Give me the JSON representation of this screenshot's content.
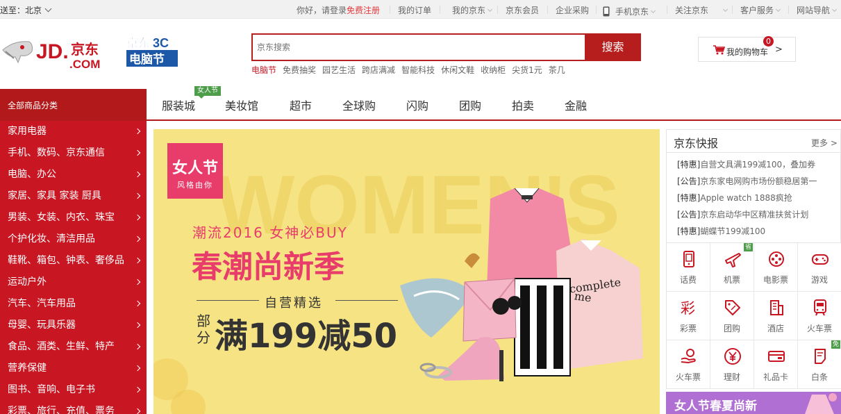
{
  "topbar": {
    "location_label": "送至：北京",
    "greeting": "你好，请登录",
    "register": "免费注册",
    "links": [
      "我的订单",
      "我的京东",
      "京东会员",
      "企业采购",
      "手机京东",
      "关注京东",
      "客户服务",
      "网站导航"
    ]
  },
  "header": {
    "logo_text": "JD.京东 .COM",
    "promo_logo_text": "京东电脑节",
    "search_placeholder": "京东搜索",
    "search_button": "搜索",
    "hotwords": [
      "电脑节",
      "免费抽奖",
      "园艺生活",
      "跨店满减",
      "智能科技",
      "休闲文鞋",
      "收纳柜",
      "尖货1元",
      "茶几"
    ],
    "cart_label": "我的购物车",
    "cart_arrow": ">",
    "cart_count": "0"
  },
  "nav": {
    "all_categories": "全部商品分类",
    "items": [
      "服装城",
      "美妆馆",
      "超市",
      "全球购",
      "闪购",
      "团购",
      "拍卖",
      "金融"
    ],
    "badge": "女人节"
  },
  "categories": [
    "家用电器",
    "手机、数码、京东通信",
    "电脑、办公",
    "家居、家具 家装 厨具",
    "男装、女装、内衣、珠宝",
    "个护化妆、清洁用品",
    "鞋靴、箱包、钟表、奢侈品",
    "运动户外",
    "汽车、汽车用品",
    "母婴、玩具乐器",
    "食品、酒类、生鲜、特产",
    "营养保健",
    "图书、音响、电子书",
    "彩票、旅行、充值、票务"
  ],
  "banner": {
    "brand_title": "女人节",
    "brand_sub": "风格由你",
    "bg_text": "WOMEN'S",
    "line1": "潮流2016  女神必BUY",
    "headline": "春潮尚新季",
    "self_pick": "自营精选",
    "partial": "部分",
    "offer": "满199减50",
    "sweater_text": "complete me"
  },
  "news": {
    "title": "京东快报",
    "more": "更多 >",
    "items": [
      {
        "tag": "[特惠]",
        "text": "自营文具满199减100，叠加券"
      },
      {
        "tag": "[公告]",
        "text": "京东家电网购市场份额稳居第一"
      },
      {
        "tag": "[特惠]",
        "text": "Apple watch 1888疯抢"
      },
      {
        "tag": "[公告]",
        "text": "京东启动华中区精准扶贫计划"
      },
      {
        "tag": "[特惠]",
        "text": "蝴蝶节199减100"
      }
    ]
  },
  "services": [
    {
      "label": "话费",
      "icon": "phone-icon"
    },
    {
      "label": "机票",
      "icon": "plane-icon",
      "corner": "省"
    },
    {
      "label": "电影票",
      "icon": "film-reel-icon"
    },
    {
      "label": "游戏",
      "icon": "gamepad-icon"
    },
    {
      "label": "彩票",
      "icon": "lottery-icon"
    },
    {
      "label": "团购",
      "icon": "tag-icon"
    },
    {
      "label": "酒店",
      "icon": "hotel-icon"
    },
    {
      "label": "火车票",
      "icon": "train-icon"
    },
    {
      "label": "火车票",
      "icon": "hand-coin-icon"
    },
    {
      "label": "理财",
      "icon": "yen-icon"
    },
    {
      "label": "礼品卡",
      "icon": "giftcard-icon"
    },
    {
      "label": "白条",
      "icon": "note-icon",
      "corner": "免"
    }
  ],
  "ad_bottom": {
    "text": "女人节春夏尚新"
  },
  "colors": {
    "brand_red": "#c81623",
    "dark_red": "#b1191a",
    "banner_bg": "#f6e384",
    "pink": "#e83c6b"
  }
}
